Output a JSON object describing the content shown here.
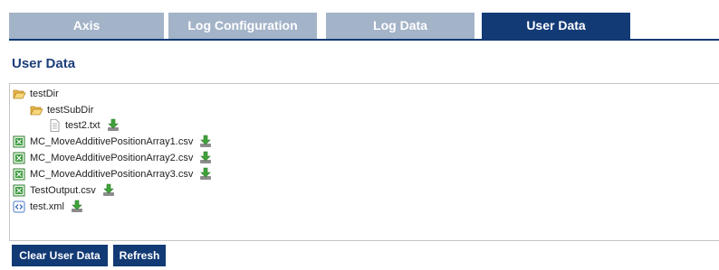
{
  "tabs": [
    {
      "label": "Axis",
      "active": false
    },
    {
      "label": "Log Configuration",
      "active": false
    },
    {
      "label": "Log Data",
      "active": false
    },
    {
      "label": "User Data",
      "active": true
    }
  ],
  "page_title": "User Data",
  "tree": {
    "items": [
      {
        "label": "testDir",
        "icon": "folder-open-icon",
        "has_download": false
      },
      {
        "label": "testSubDir",
        "icon": "folder-open-icon",
        "has_download": false
      },
      {
        "label": "test2.txt",
        "icon": "text-file-icon",
        "has_download": true
      },
      {
        "label": "MC_MoveAdditivePositionArray1.csv",
        "icon": "csv-file-icon",
        "has_download": true
      },
      {
        "label": "MC_MoveAdditivePositionArray2.csv",
        "icon": "csv-file-icon",
        "has_download": true
      },
      {
        "label": "MC_MoveAdditivePositionArray3.csv",
        "icon": "csv-file-icon",
        "has_download": true
      },
      {
        "label": "TestOutput.csv",
        "icon": "csv-file-icon",
        "has_download": true
      },
      {
        "label": "test.xml",
        "icon": "xml-file-icon",
        "has_download": true
      }
    ]
  },
  "buttons": {
    "clear_label": "Clear User Data",
    "refresh_label": "Refresh"
  },
  "colors": {
    "active_tab": "#123a75",
    "inactive_tab": "#a3b3c8",
    "title": "#1d3f7a",
    "button": "#123a75"
  }
}
